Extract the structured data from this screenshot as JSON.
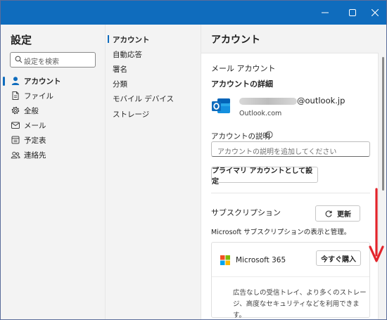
{
  "left": {
    "title": "設定",
    "search_placeholder": "設定を検索",
    "items": [
      {
        "label": "アカウント",
        "icon": "person-icon",
        "active": true
      },
      {
        "label": "ファイル",
        "icon": "file-icon"
      },
      {
        "label": "全般",
        "icon": "gear-icon"
      },
      {
        "label": "メール",
        "icon": "mail-icon"
      },
      {
        "label": "予定表",
        "icon": "calendar-icon"
      },
      {
        "label": "連絡先",
        "icon": "people-icon"
      }
    ]
  },
  "middle": {
    "items": [
      {
        "label": "アカウント",
        "active": true
      },
      {
        "label": "自動応答"
      },
      {
        "label": "署名"
      },
      {
        "label": "分類"
      },
      {
        "label": "モバイル デバイス"
      },
      {
        "label": "ストレージ"
      }
    ]
  },
  "right": {
    "title": "アカウント",
    "mail_account_heading": "メール アカウント",
    "account_details_heading": "アカウントの詳細",
    "email_domain": "@outlook.jp",
    "email_provider": "Outlook.com",
    "description_label": "アカウントの説明",
    "description_placeholder": "アカウントの説明を追加してください",
    "primary_button": "プライマリ アカウントとして設定",
    "subscription_heading": "サブスクリプション",
    "refresh_button": "更新",
    "subscription_desc": "Microsoft サブスクリプションの表示と管理。",
    "product_name": "Microsoft 365",
    "buy_button": "今すぐ購入",
    "product_desc": "広告なしの受信トレイ、より多くのストレージ、高度なセキュリティなどを利用できます。"
  },
  "colors": {
    "accent": "#0f6cbd",
    "arrow": "#e3242b"
  }
}
